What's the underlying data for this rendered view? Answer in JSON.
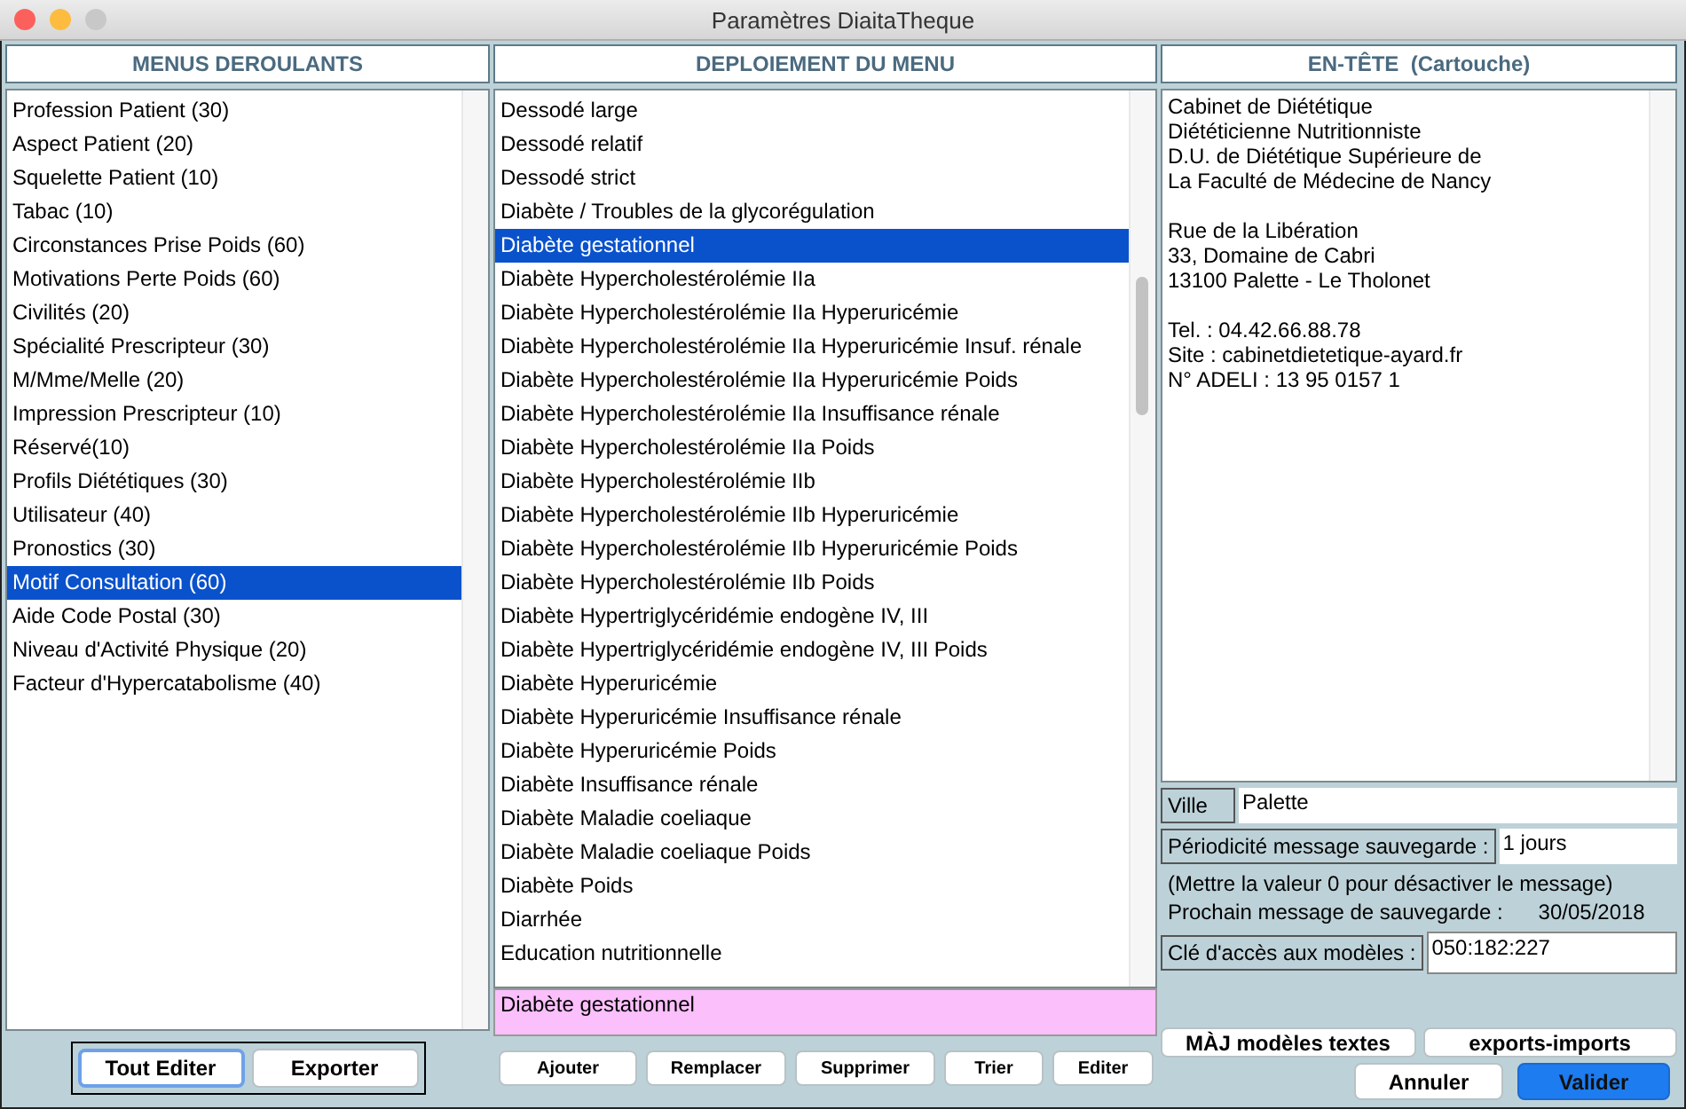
{
  "window": {
    "title": "Paramètres DiaitaTheque"
  },
  "menus": {
    "title": "MENUS DEROULANTS",
    "items": [
      {
        "label": "Profession Patient (30)",
        "selected": false
      },
      {
        "label": "Aspect Patient (20)",
        "selected": false
      },
      {
        "label": "Squelette Patient (10)",
        "selected": false
      },
      {
        "label": "Tabac (10)",
        "selected": false
      },
      {
        "label": "Circonstances Prise Poids (60)",
        "selected": false
      },
      {
        "label": "Motivations Perte Poids (60)",
        "selected": false
      },
      {
        "label": "Civilités (20)",
        "selected": false
      },
      {
        "label": "Spécialité Prescripteur (30)",
        "selected": false
      },
      {
        "label": "M/Mme/Melle (20)",
        "selected": false
      },
      {
        "label": "Impression Prescripteur (10)",
        "selected": false
      },
      {
        "label": "Réservé(10)",
        "selected": false
      },
      {
        "label": "Profils Diététiques (30)",
        "selected": false
      },
      {
        "label": "Utilisateur (40)",
        "selected": false
      },
      {
        "label": "Pronostics (30)",
        "selected": false
      },
      {
        "label": "Motif Consultation (60)",
        "selected": true
      },
      {
        "label": "Aide Code Postal (30)",
        "selected": false
      },
      {
        "label": "Niveau d'Activité Physique (20)",
        "selected": false
      },
      {
        "label": "Facteur d'Hypercatabolisme (40)",
        "selected": false
      }
    ],
    "buttons": [
      {
        "label": "Tout Editer",
        "focused": true
      },
      {
        "label": "Exporter",
        "focused": false
      }
    ]
  },
  "deploiement": {
    "title": "DEPLOIEMENT DU MENU",
    "items": [
      {
        "label": "Dessodé large",
        "selected": false
      },
      {
        "label": "Dessodé relatif",
        "selected": false
      },
      {
        "label": "Dessodé strict",
        "selected": false
      },
      {
        "label": "Diabète / Troubles de la glycorégulation",
        "selected": false
      },
      {
        "label": "Diabète gestationnel",
        "selected": true
      },
      {
        "label": "Diabète Hypercholestérolémie IIa",
        "selected": false
      },
      {
        "label": "Diabète Hypercholestérolémie IIa Hyperuricémie",
        "selected": false
      },
      {
        "label": "Diabète Hypercholestérolémie IIa Hyperuricémie Insuf. rénale",
        "selected": false
      },
      {
        "label": "Diabète Hypercholestérolémie IIa Hyperuricémie Poids",
        "selected": false
      },
      {
        "label": "Diabète Hypercholestérolémie IIa Insuffisance rénale",
        "selected": false
      },
      {
        "label": "Diabète Hypercholestérolémie IIa Poids",
        "selected": false
      },
      {
        "label": "Diabète Hypercholestérolémie IIb",
        "selected": false
      },
      {
        "label": "Diabète Hypercholestérolémie IIb Hyperuricémie",
        "selected": false
      },
      {
        "label": "Diabète Hypercholestérolémie IIb Hyperuricémie Poids",
        "selected": false
      },
      {
        "label": "Diabète Hypercholestérolémie IIb Poids",
        "selected": false
      },
      {
        "label": "Diabète Hypertriglycéridémie endogène IV, III",
        "selected": false
      },
      {
        "label": "Diabète Hypertriglycéridémie endogène IV, III Poids",
        "selected": false
      },
      {
        "label": "Diabète Hyperuricémie",
        "selected": false
      },
      {
        "label": "Diabète Hyperuricémie Insuffisance rénale",
        "selected": false
      },
      {
        "label": "Diabète Hyperuricémie Poids",
        "selected": false
      },
      {
        "label": "Diabète Insuffisance rénale",
        "selected": false
      },
      {
        "label": "Diabète Maladie coeliaque",
        "selected": false
      },
      {
        "label": "Diabète Maladie coeliaque Poids",
        "selected": false
      },
      {
        "label": "Diabète Poids",
        "selected": false
      },
      {
        "label": "Diarrhée",
        "selected": false
      },
      {
        "label": "Education nutritionnelle",
        "selected": false
      }
    ],
    "edit_value": "Diabète gestationnel",
    "buttons": [
      "Ajouter",
      "Remplacer",
      "Supprimer",
      "Trier",
      "Editer"
    ]
  },
  "entete": {
    "title": "EN-TÊTE  (Cartouche)",
    "text": "Cabinet de Diététique\nDiététicienne Nutritionniste\nD.U. de Diététique Supérieure de\nLa Faculté de Médecine de Nancy\n\nRue de la Libération\n33, Domaine de Cabri\n13100 Palette - Le Tholonet\n\nTel. : 04.42.66.88.78\nSite : cabinetdietetique-ayard.fr\nN° ADELI : 13 95 0157 1",
    "ville": {
      "label": "Ville",
      "value": "Palette"
    },
    "periodicite": {
      "label": "Périodicité message sauvegarde :",
      "value": "1 jours"
    },
    "note": "(Mettre la valeur 0 pour désactiver le message)",
    "prochain": {
      "label": "Prochain message de sauvegarde :",
      "value": "30/05/2018"
    },
    "cle": {
      "label": "Clé d'accès aux modèles :",
      "value": "050:182:227"
    },
    "buttons": [
      "MÀJ modèles textes",
      "exports-imports"
    ],
    "cancel": "Annuler",
    "ok": "Valider"
  }
}
